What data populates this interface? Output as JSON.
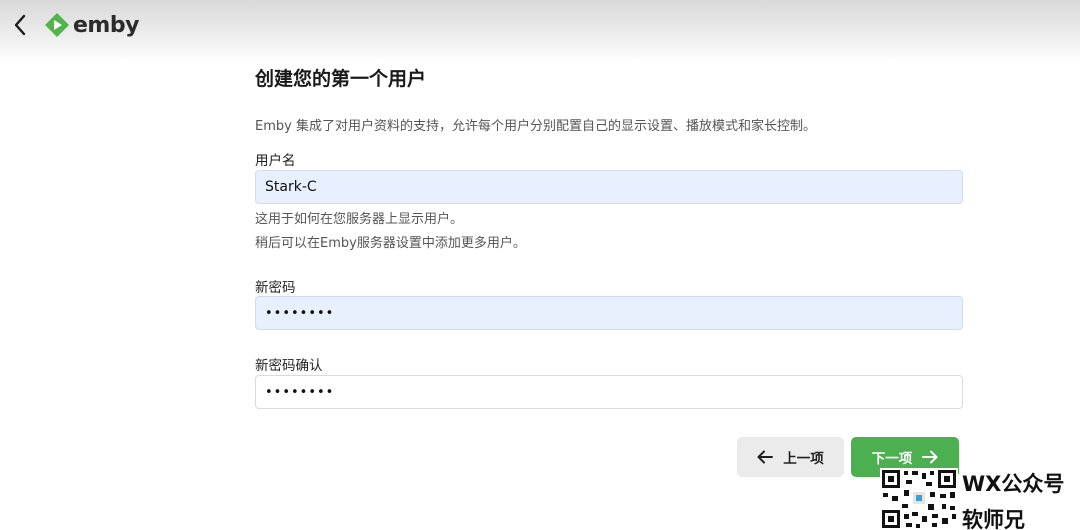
{
  "header": {
    "logo_text": "emby",
    "brand_color": "#52b54b"
  },
  "page": {
    "title": "创建您的第一个用户",
    "description": "Emby 集成了对用户资料的支持，允许每个用户分别配置自己的显示设置、播放模式和家长控制。"
  },
  "form": {
    "username_label": "用户名",
    "username_value": "Stark-C",
    "username_help_1": "这用于如何在您服务器上显示用户。",
    "username_help_2": "稍后可以在Emby服务器设置中添加更多用户。",
    "password_label": "新密码",
    "password_value": "••••••••",
    "confirm_label": "新密码确认",
    "confirm_value": "••••••••"
  },
  "buttons": {
    "prev_label": "上一项",
    "next_label": "下一项",
    "next_color": "#4caf50"
  },
  "watermark": {
    "line1": "WX公众号",
    "line2": "软师兄"
  }
}
